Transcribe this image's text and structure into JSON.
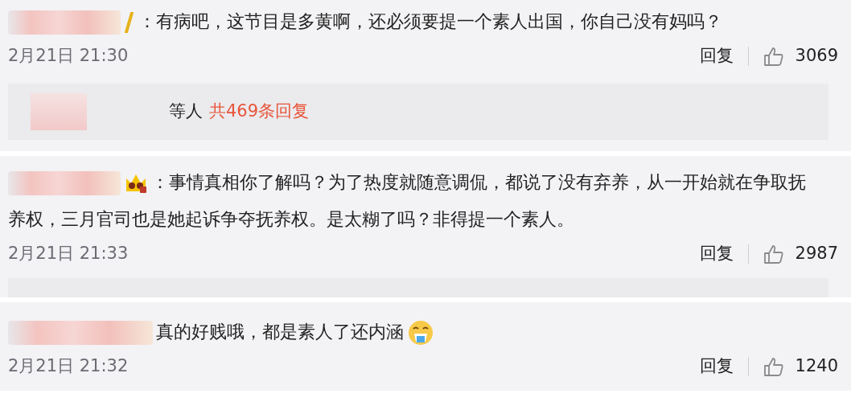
{
  "comments": [
    {
      "kind": "pen",
      "text": "：有病吧，这节目是多黄啊，还必须要提一个素人出国，你自己没有妈吗？",
      "trailing_emoji": false,
      "time": "2月21日 21:30",
      "reply_label": "回复",
      "likes": "3069",
      "replies": {
        "kind": "summary",
        "prefix": "等人",
        "link": "共469条回复"
      }
    },
    {
      "kind": "crown",
      "text": "：事情真相你了解吗？为了热度就随意调侃，都说了没有弃养，从一开始就在争取抚养权，三月官司也是她起诉争夺抚养权。是太糊了吗？非得提一个素人。",
      "trailing_emoji": false,
      "time": "2月21日 21:33",
      "reply_label": "回复",
      "likes": "2987",
      "replies": {
        "kind": "cut"
      }
    },
    {
      "kind": "plain",
      "text": "真的好贱哦，都是素人了还内涵",
      "trailing_emoji": true,
      "time": "2月21日 21:32",
      "reply_label": "回复",
      "likes": "1240"
    }
  ]
}
